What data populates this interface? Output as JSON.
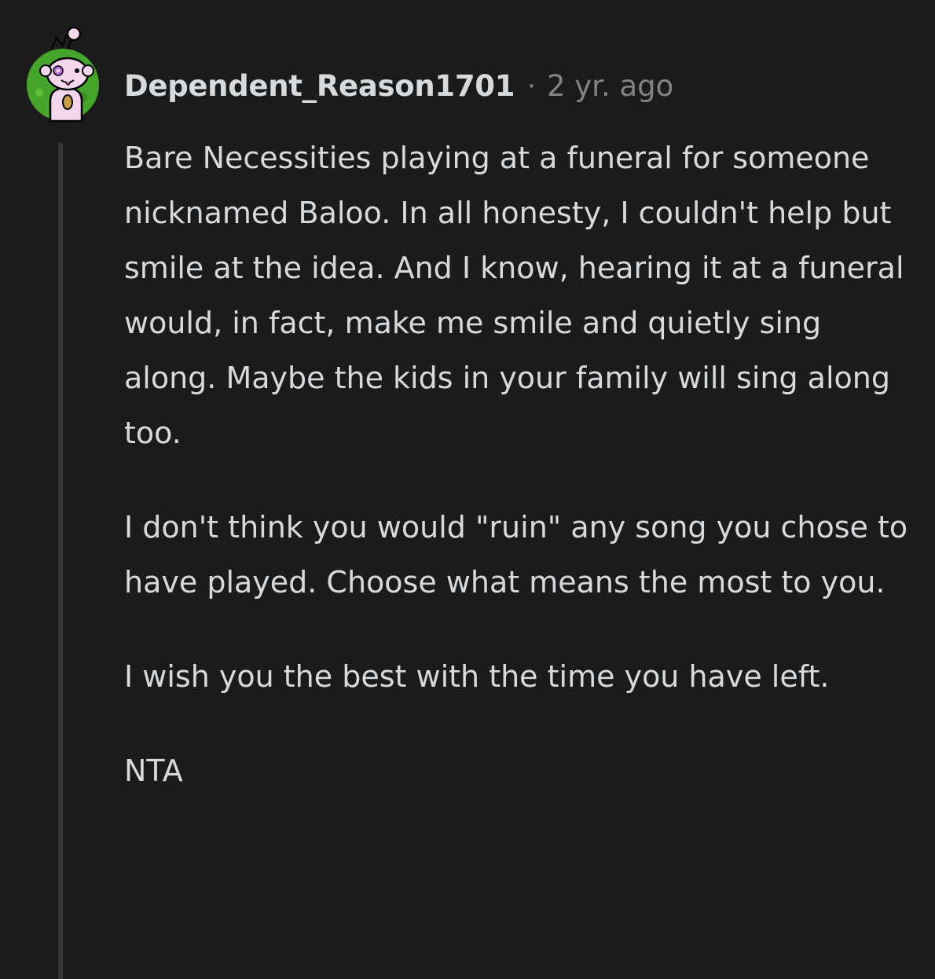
{
  "comment": {
    "author": "Dependent_Reason1701",
    "separator": "·",
    "timestamp": "2 yr. ago",
    "avatar_icon": "snoo-avatar-icon",
    "paragraphs": [
      "Bare Necessities playing at a funeral for someone nicknamed Baloo. In all honesty, I couldn't help but smile at the idea. And I know, hearing it at a funeral would, in fact, make me smile and quietly sing along. Maybe the kids in your family will sing along too.",
      "I don't think you would \"ruin\" any song you chose to have played. Choose what means the most to you.",
      "I wish you the best with the time you have left.",
      "NTA"
    ]
  },
  "colors": {
    "background": "#1b1b1c",
    "text": "#d7dadc",
    "meta": "#818384",
    "thread_line": "#343536",
    "avatar_green": "#46a62c"
  }
}
